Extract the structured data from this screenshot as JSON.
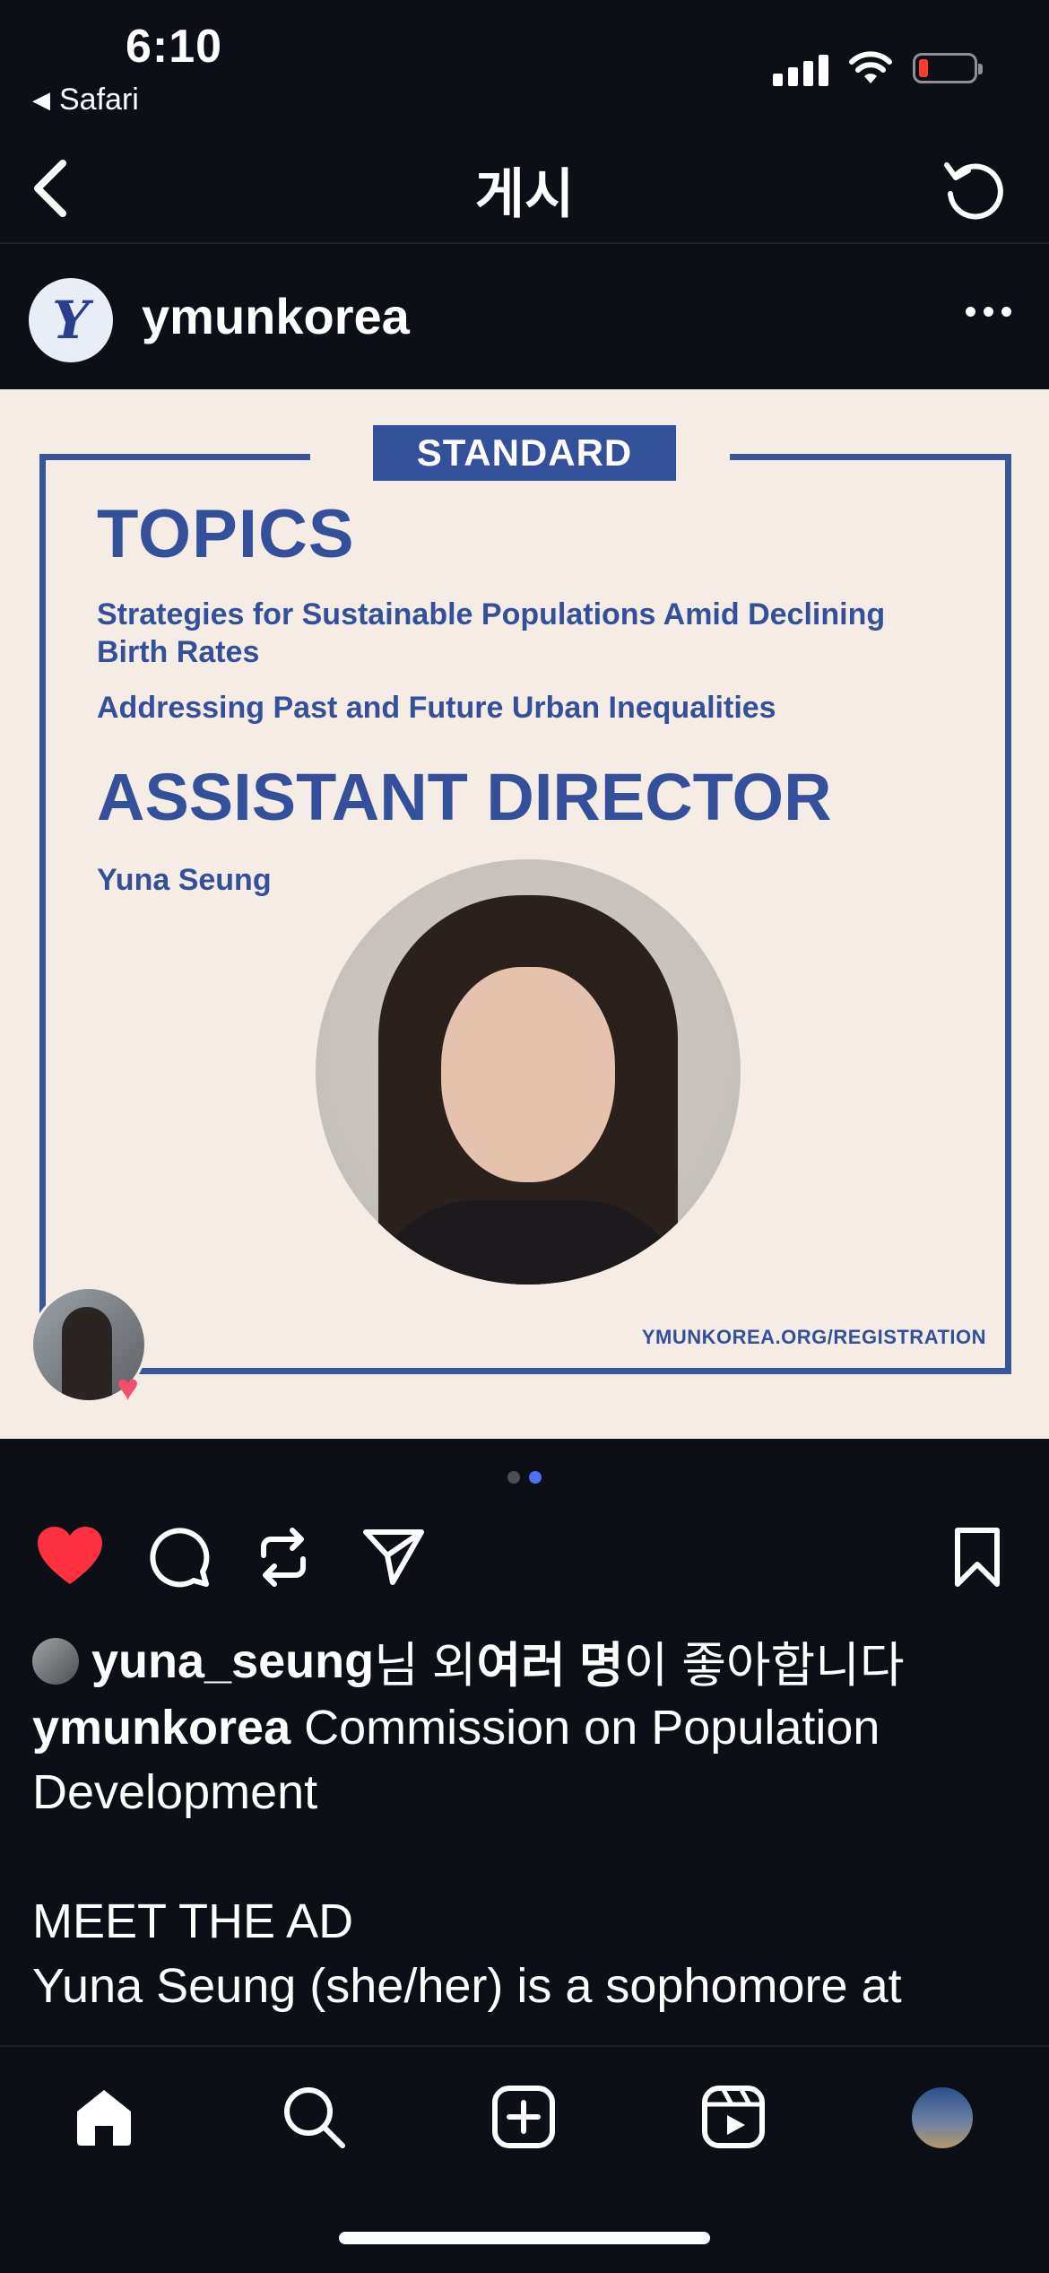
{
  "status_bar": {
    "time": "6:10",
    "back_app": "Safari",
    "battery_color": "#ff3b30"
  },
  "header": {
    "title": "게시",
    "back_icon": "chevron-left-icon",
    "refresh_icon": "refresh-icon"
  },
  "post": {
    "username": "ymunkorea",
    "more_icon": "more-horizontal-icon",
    "image": {
      "badge": "STANDARD",
      "topics_heading": "TOPICS",
      "topics": [
        "Strategies for Sustainable Populations Amid Declining Birth Rates",
        "Addressing Past and Future Urban Inequalities"
      ],
      "role_heading": "ASSISTANT DIRECTOR",
      "person_name": "Yuna Seung",
      "url": "YMUNKOREA.ORG/REGISTRATION",
      "accent_color": "#34509a",
      "background_color": "#f6ece6"
    },
    "carousel": {
      "total": 2,
      "active": 2
    },
    "actions": {
      "like_icon": "heart-filled-icon",
      "comment_icon": "comment-icon",
      "repost_icon": "repost-icon",
      "share_icon": "send-icon",
      "save_icon": "bookmark-icon",
      "like_color": "#ff3040"
    },
    "likes": {
      "user": "yuna_seung",
      "suffix_1": "님 외 ",
      "others": "여러 명",
      "suffix_2": "이 좋아합니다"
    },
    "caption": {
      "author": "ymunkorea",
      "line_1": " Commission on Population",
      "line_2": "Development",
      "line_3": "MEET THE AD",
      "line_4": "Yuna Seung (she/her) is a sophomore at"
    }
  },
  "tab_bar": {
    "items": [
      "home-icon",
      "search-icon",
      "create-icon",
      "reels-icon",
      "profile-avatar"
    ]
  }
}
